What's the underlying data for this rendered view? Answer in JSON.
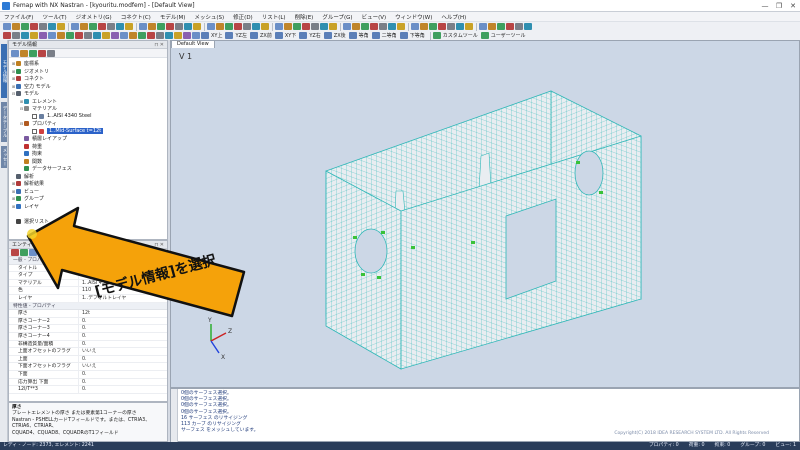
{
  "window": {
    "title": "Femap with NX Nastran - [kyouritu.modfem] - [Default View]",
    "controls": [
      "—",
      "❐",
      "✕"
    ]
  },
  "menu": [
    "ファイル(F)",
    "ツール(T)",
    "ジオメトリ(G)",
    "コネクト(C)",
    "モデル(M)",
    "メッシュ(S)",
    "修正(D)",
    "リスト(L)",
    "削除(E)",
    "グループ(G)",
    "ビュー(V)",
    "ウィンドウ(W)",
    "ヘルプ(H)"
  ],
  "toolbar": {
    "view_labels": [
      "XY上",
      "YZ左",
      "ZX前",
      "XY下",
      "YZ右",
      "ZX後",
      "等角",
      "二等角",
      "下等角"
    ],
    "custom_tools": "カスタムツール",
    "user_tools": "ユーザーツール"
  },
  "side_tabs": [
    "モデル情報",
    "データテーブル",
    "メッセージ"
  ],
  "model_info": {
    "header": "モデル情報",
    "tree": [
      {
        "label": "座標系",
        "level": 0,
        "exp": "⊞",
        "icon": "#c08020"
      },
      {
        "label": "ジオメトリ",
        "level": 0,
        "exp": "⊞",
        "icon": "#2f8f4f"
      },
      {
        "label": "コネクト",
        "level": 0,
        "exp": "⊞",
        "icon": "#b03a3a"
      },
      {
        "label": "空力 モデル",
        "level": 0,
        "exp": "⊞",
        "icon": "#3a6fb3"
      },
      {
        "label": "モデル",
        "level": 0,
        "exp": "⊟",
        "icon": "#555f6d"
      },
      {
        "label": "エレメント",
        "level": 1,
        "exp": "⊞",
        "icon": "#2f8fb0"
      },
      {
        "label": "マテリアル",
        "level": 1,
        "exp": "⊟",
        "icon": "#888888"
      },
      {
        "label": "1..AISI 4340 Steel",
        "level": 2,
        "exp": "",
        "icon": "#6a7fa0",
        "check": true
      },
      {
        "label": "プロパティ",
        "level": 1,
        "exp": "⊟",
        "icon": "#b05a20"
      },
      {
        "label": "1..Mid-Surface t=12t",
        "level": 2,
        "exp": "",
        "icon": "#d04040",
        "check": true,
        "selected": true
      },
      {
        "label": "積層レイアップ",
        "level": 1,
        "exp": "",
        "icon": "#7a5aa0"
      },
      {
        "label": "荷重",
        "level": 1,
        "exp": "",
        "icon": "#c03030"
      },
      {
        "label": "拘束",
        "level": 1,
        "exp": "",
        "icon": "#3070c0"
      },
      {
        "label": "関数",
        "level": 1,
        "exp": "",
        "icon": "#c08020"
      },
      {
        "label": "データサーフェス",
        "level": 1,
        "exp": "",
        "icon": "#2f8f4f"
      },
      {
        "label": "解析",
        "level": 0,
        "exp": "",
        "icon": "#555f6d"
      },
      {
        "label": "解析結果",
        "level": 0,
        "exp": "⊞",
        "icon": "#b03a3a"
      },
      {
        "label": "ビュー",
        "level": 0,
        "exp": "⊞",
        "icon": "#3a6fb3"
      },
      {
        "label": "グループ",
        "level": 0,
        "exp": "⊞",
        "icon": "#2f8f4f"
      },
      {
        "label": "レイヤ",
        "level": 0,
        "exp": "⊞",
        "icon": "#3070c0"
      },
      {
        "label": "",
        "level": 0,
        "exp": "",
        "icon": ""
      },
      {
        "label": "選択リスト",
        "level": 0,
        "exp": "",
        "icon": "#444444"
      }
    ]
  },
  "entity_editor": {
    "header": "エンティティエディタ",
    "section1": "一般 - プロパティ",
    "rows1": [
      {
        "k": "タイトル",
        "v": ""
      },
      {
        "k": "タイプ",
        "v": "プレート"
      },
      {
        "k": "マテリアル",
        "v": "1..AISI 4340 Steel"
      },
      {
        "k": "色",
        "v": "110"
      },
      {
        "k": "レイヤ",
        "v": "1..デフォルトレイヤ"
      }
    ],
    "section2": "特性値 - プロパティ",
    "rows2": [
      {
        "k": "厚さ",
        "v": "12t"
      },
      {
        "k": "厚さコーナー2",
        "v": "0."
      },
      {
        "k": "厚さコーナー3",
        "v": "0."
      },
      {
        "k": "厚さコーナー4",
        "v": "0."
      },
      {
        "k": "非構造質量/面積",
        "v": "0."
      },
      {
        "k": "上面オフセットのフラグ",
        "v": "いいえ"
      },
      {
        "k": "上面",
        "v": "0."
      },
      {
        "k": "下面オフセットのフラグ",
        "v": "いいえ"
      },
      {
        "k": "下面",
        "v": "0."
      },
      {
        "k": "応力算出 下面",
        "v": "0."
      },
      {
        "k": "12I/T**3",
        "v": "0."
      }
    ]
  },
  "help": {
    "title": "厚さ",
    "lines": [
      "プレートエレメントの厚さ または要素第1コーナーの厚さ",
      "Nastran - PSHELLカードTフィールドです。または、CTRIA3、CTRIA6、CTRIAR、",
      "CQUAD4、CQUAD8、CQUADRのT1フィールド"
    ]
  },
  "viewport": {
    "tab": "Default View",
    "label": "V 1",
    "axis": {
      "x": "X",
      "y": "Y",
      "z": "Z"
    }
  },
  "callout": {
    "text": "[モデル情報]を選択"
  },
  "messages": {
    "lines": [
      "0個のサーフェス選択。",
      "0個のサーフェス選択。",
      "0個のサーフェス選択。",
      "0個のサーフェス選択。",
      "16 サーフェス のリサイジング",
      "113 カーブ のリサイジング",
      "サーフェス をメッシュしています。"
    ],
    "copyright": "Copyright(C) 2018 IDEA RESEARCH SYSTEM LTD. All Rights Reserved"
  },
  "status": {
    "left": "レディ - ノード: 2373, エレメント: 2241",
    "right": [
      "プロパティ: 0",
      "荷重: 0",
      "拘束: 0",
      "グループ: 0",
      "ビュー: 1"
    ]
  },
  "colors": {
    "mesh_fill": "#e9edf1",
    "mesh_line": "#2fb7b7",
    "arrow": "#f5a20a",
    "arrow_edge": "#111111",
    "viewport_bg": "#ccd7e6"
  }
}
